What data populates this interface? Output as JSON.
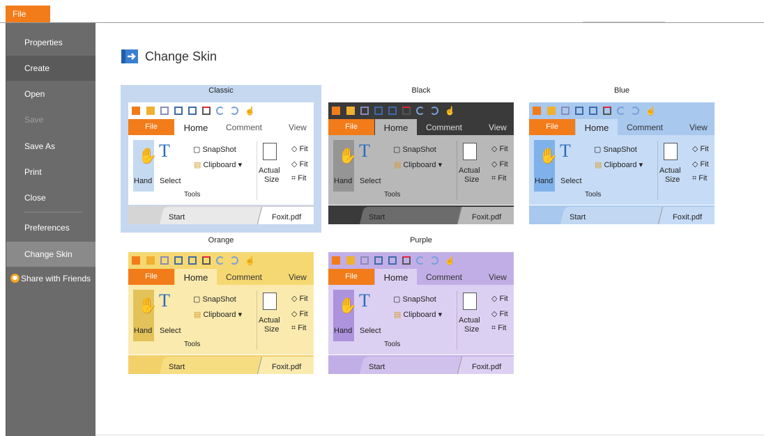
{
  "top": {
    "file_label": "File"
  },
  "sidebar": {
    "items": [
      {
        "label": "Properties"
      },
      {
        "label": "Create"
      },
      {
        "label": "Open"
      },
      {
        "label": "Save"
      },
      {
        "label": "Save As"
      },
      {
        "label": "Print"
      },
      {
        "label": "Close"
      },
      {
        "label": "Preferences"
      },
      {
        "label": "Change Skin"
      }
    ],
    "share_label": "Share with Friends"
  },
  "main": {
    "title": "Change Skin"
  },
  "preview_text": {
    "file": "File",
    "home": "Home",
    "comment": "Comment",
    "view": "View",
    "hand": "Hand",
    "select": "Select",
    "snapshot": "SnapShot",
    "clipboard": "Clipboard",
    "actual": "Actual",
    "size": "Size",
    "fit": "Fit",
    "tools": "Tools",
    "start": "Start",
    "foxit": "Foxit.pdf"
  },
  "skins": [
    {
      "name": "Classic",
      "selected": true,
      "colors": {
        "qat": "#ffffff",
        "tabs": "#ffffff",
        "home_tab": "#ffffff",
        "ribbon": "#ffffff",
        "hand": "#c5d9f1",
        "doctabs": "#d5d5d5",
        "start_tab": "#e9e9e9",
        "text": "#222222",
        "dim": "#555555"
      }
    },
    {
      "name": "Black",
      "selected": false,
      "colors": {
        "qat": "#3a3a3a",
        "tabs": "#3a3a3a",
        "home_tab": "#b8b8b8",
        "ribbon": "#b8b8b8",
        "hand": "#959595",
        "doctabs": "#3a3a3a",
        "start_tab": "#6c6c6c",
        "text": "#222222",
        "dim": "#dddddd"
      }
    },
    {
      "name": "Blue",
      "selected": false,
      "colors": {
        "qat": "#a8c8ee",
        "tabs": "#a8c8ee",
        "home_tab": "#c6dcf6",
        "ribbon": "#c6dcf6",
        "hand": "#7fb2ea",
        "doctabs": "#a8c8ee",
        "start_tab": "#c2d8f2",
        "text": "#222222",
        "dim": "#333333"
      }
    },
    {
      "name": "Orange",
      "selected": false,
      "colors": {
        "qat": "#f6d872",
        "tabs": "#f6d872",
        "home_tab": "#faeaae",
        "ribbon": "#faeaae",
        "hand": "#e3c25a",
        "doctabs": "#f2d06a",
        "start_tab": "#f7dd82",
        "text": "#222222",
        "dim": "#333333"
      }
    },
    {
      "name": "Purple",
      "selected": false,
      "colors": {
        "qat": "#c2aee6",
        "tabs": "#c2aee6",
        "home_tab": "#dcd0f2",
        "ribbon": "#dcd0f2",
        "hand": "#ad92dd",
        "doctabs": "#c2aee6",
        "start_tab": "#d0c0ec",
        "text": "#222222",
        "dim": "#333333"
      }
    }
  ],
  "accent": "#f27c1a"
}
